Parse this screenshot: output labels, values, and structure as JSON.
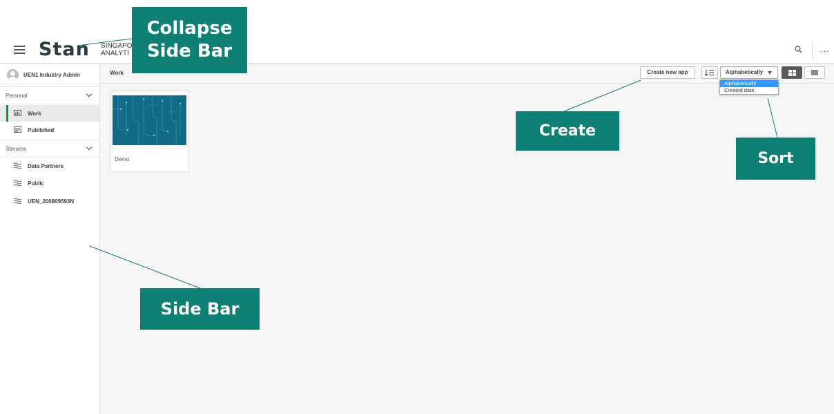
{
  "header": {
    "logo": "Stan",
    "logo_subtitle_line1": "SINGAPO",
    "logo_subtitle_line2": "ANALYTI",
    "more_label": "..."
  },
  "sidebar": {
    "user_name": "UEN1 Industry Admin",
    "personal_label": "Personal",
    "streams_label": "Streams",
    "personal_items": [
      {
        "label": "Work",
        "active": true,
        "icon": "work-icon"
      },
      {
        "label": "Published",
        "active": false,
        "icon": "published-icon"
      }
    ],
    "stream_items": [
      {
        "label": "Data Partners",
        "icon": "stream-icon"
      },
      {
        "label": "Public",
        "icon": "stream-icon"
      },
      {
        "label": "UEN_200809593N",
        "icon": "stream-icon"
      }
    ]
  },
  "toolbar": {
    "breadcrumb": "Work",
    "create_label": "Create new app",
    "sort_selected": "Alphabetically",
    "sort_options": [
      "Alphabetically",
      "Created date"
    ]
  },
  "apps": [
    {
      "name": "Demo"
    }
  ],
  "annotations": {
    "collapse_line1": "Collapse",
    "collapse_line2": "Side Bar",
    "create": "Create",
    "sort": "Sort",
    "sidebar": "Side Bar"
  },
  "colors": {
    "accent_green": "#009845",
    "callout_teal": "#0e7f73",
    "dropdown_highlight": "#3399ff",
    "thumbnail_blue": "#0f6b86"
  }
}
